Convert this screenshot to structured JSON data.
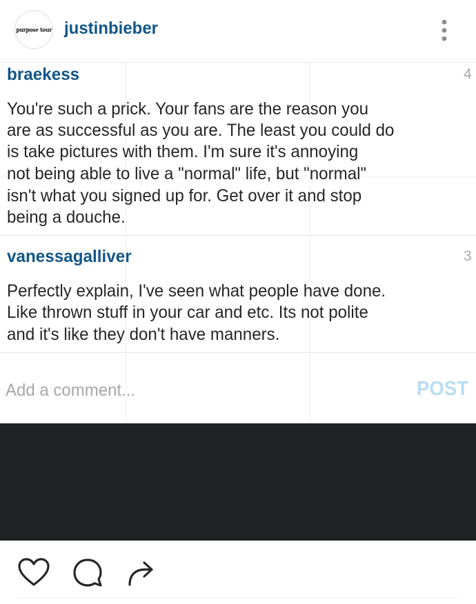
{
  "header": {
    "avatar_text": "purpose tour",
    "username": "justinbieber",
    "more_icon": "more-vertical-icon"
  },
  "comments": [
    {
      "username": "braekess",
      "time": "4",
      "lines": [
        "You're such a prick. Your fans are the reason you",
        "are as successful as you are. The least you could do",
        "is take pictures with them. I'm sure it's annoying",
        "not being able to live a \"normal\" life, but \"normal\"",
        "isn't what you signed up for. Get over it and stop",
        "being a douche."
      ]
    },
    {
      "username": "vanessagalliver",
      "time": "3",
      "lines": [
        "Perfectly explain,  I've seen what people have done.",
        "Like thrown stuff in your car and etc. Its not polite",
        "and it's like they don't have manners."
      ]
    }
  ],
  "comment_box": {
    "placeholder": "Add a comment...",
    "post_label": "POST",
    "post_color": "#b9dcf3"
  },
  "actions": {
    "like_icon": "heart-icon",
    "comment_icon": "comment-bubble-icon",
    "share_icon": "share-arrow-icon"
  },
  "colors": {
    "username": "#125688",
    "text": "#262626",
    "muted": "#a8a8a8",
    "dark_band": "#212224"
  }
}
